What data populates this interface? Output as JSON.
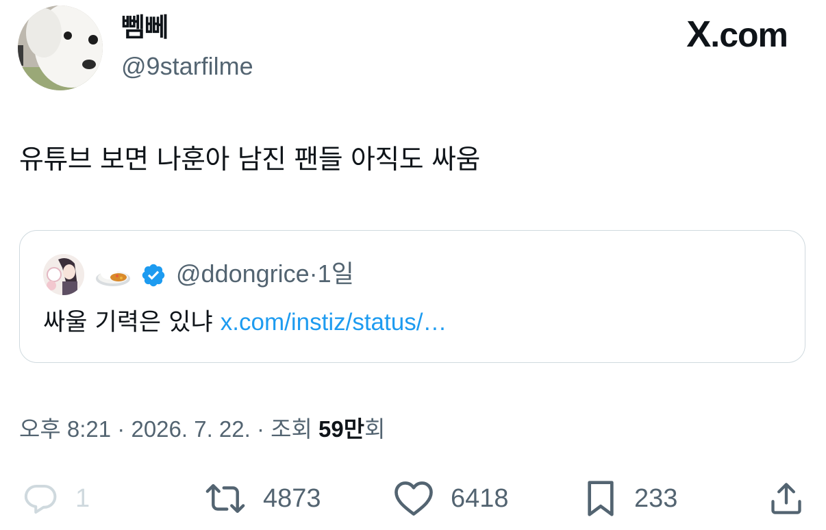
{
  "header": {
    "display_name": "뻼뻬",
    "handle": "@9starfilme",
    "brand_logo": "X",
    "brand_suffix": ".com"
  },
  "tweet": {
    "text": "유튜브 보면 나훈아 남진 팬들 아직도 싸움"
  },
  "quote": {
    "handle": "@ddongrice",
    "separator": "·",
    "age": "1일",
    "text": "싸울 기력은 있냐",
    "link": "x.com/instiz/status/…",
    "verified": true,
    "food_icon": "curry-rice-emoji"
  },
  "meta": {
    "time": "오후 8:21",
    "date": "2026. 7. 22.",
    "dot": "·",
    "views_label": "조회",
    "views_number": "59만",
    "views_suffix": "회"
  },
  "actions": {
    "reply": {
      "icon": "reply-icon",
      "count": "1"
    },
    "retweet": {
      "icon": "retweet-icon",
      "count": "4873"
    },
    "like": {
      "icon": "heart-icon",
      "count": "6418"
    },
    "bookmark": {
      "icon": "bookmark-icon",
      "count": "233"
    },
    "share": {
      "icon": "share-icon"
    }
  },
  "colors": {
    "text": "#0f1419",
    "secondary": "#536471",
    "link": "#1d9bf0",
    "border": "#cfd9de",
    "disabled": "#cfd9de"
  }
}
